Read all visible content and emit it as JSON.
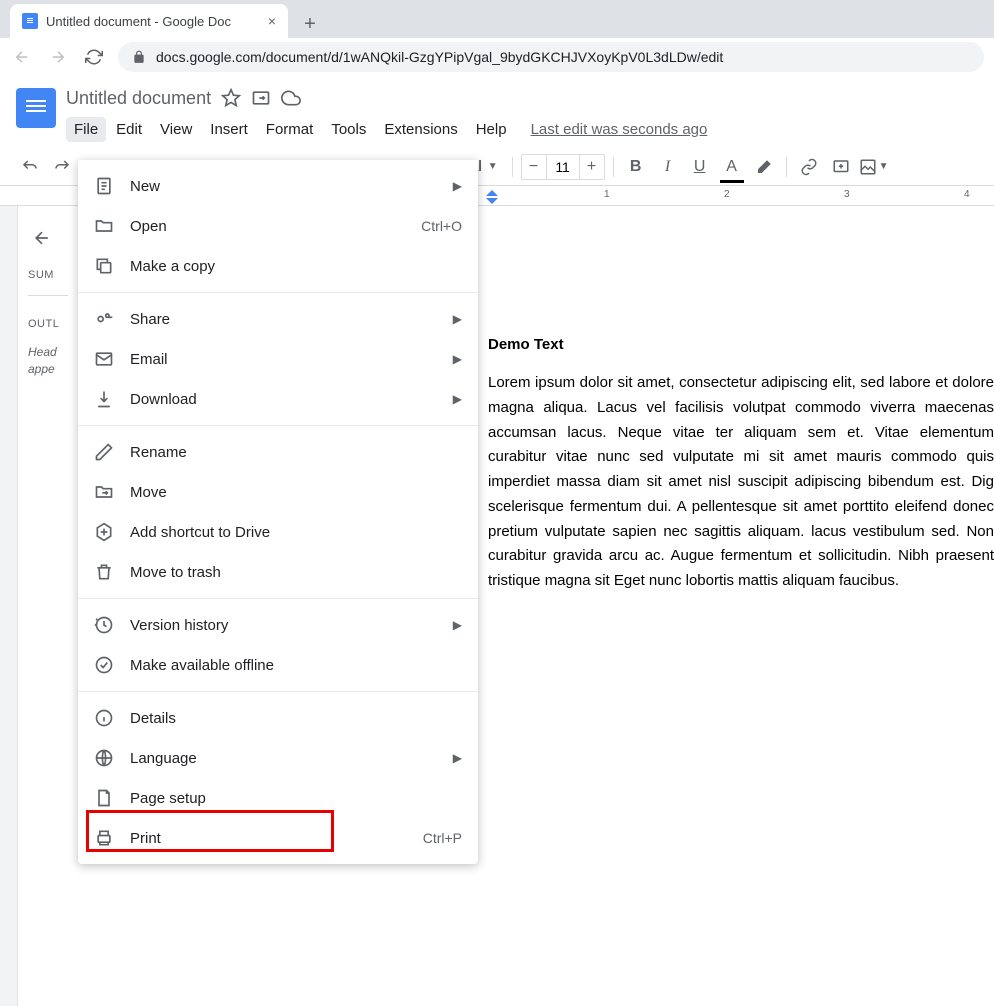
{
  "browser": {
    "tab_title": "Untitled document - Google Doc",
    "url": "docs.google.com/document/d/1wANQkil-GzgYPipVgal_9bydGKCHJVXoyKpV0L3dLDw/edit"
  },
  "doc": {
    "title": "Untitled document",
    "last_edit": "Last edit was seconds ago",
    "heading": "Demo Text",
    "body": "Lorem ipsum dolor sit amet, consectetur adipiscing elit, sed labore et dolore magna aliqua. Lacus vel facilisis volutpat commodo viverra maecenas accumsan lacus. Neque vitae ter aliquam sem et. Vitae elementum curabitur vitae nunc sed vulputate mi sit amet mauris commodo quis imperdiet massa diam sit amet nisl suscipit adipiscing bibendum est. Dig scelerisque fermentum dui. A pellentesque sit amet porttito eleifend donec pretium vulputate sapien nec sagittis aliquam. lacus vestibulum sed. Non curabitur gravida arcu ac. Augue fermentum et sollicitudin. Nibh praesent tristique magna sit Eget nunc lobortis mattis aliquam faucibus."
  },
  "menubar": {
    "file": "File",
    "edit": "Edit",
    "view": "View",
    "insert": "Insert",
    "format": "Format",
    "tools": "Tools",
    "extensions": "Extensions",
    "help": "Help"
  },
  "toolbar": {
    "style": "al",
    "font_size": "11"
  },
  "outline": {
    "summary": "SUM",
    "outline": "OUTL",
    "placeholder": "Head appe"
  },
  "file_menu": {
    "new": "New",
    "open": "Open",
    "open_sc": "Ctrl+O",
    "copy": "Make a copy",
    "share": "Share",
    "email": "Email",
    "download": "Download",
    "rename": "Rename",
    "move": "Move",
    "shortcut": "Add shortcut to Drive",
    "trash": "Move to trash",
    "version": "Version history",
    "offline": "Make available offline",
    "details": "Details",
    "language": "Language",
    "pagesetup": "Page setup",
    "print": "Print",
    "print_sc": "Ctrl+P"
  },
  "ruler": {
    "t1": "1",
    "t2": "2",
    "t3": "3",
    "t4": "4"
  }
}
